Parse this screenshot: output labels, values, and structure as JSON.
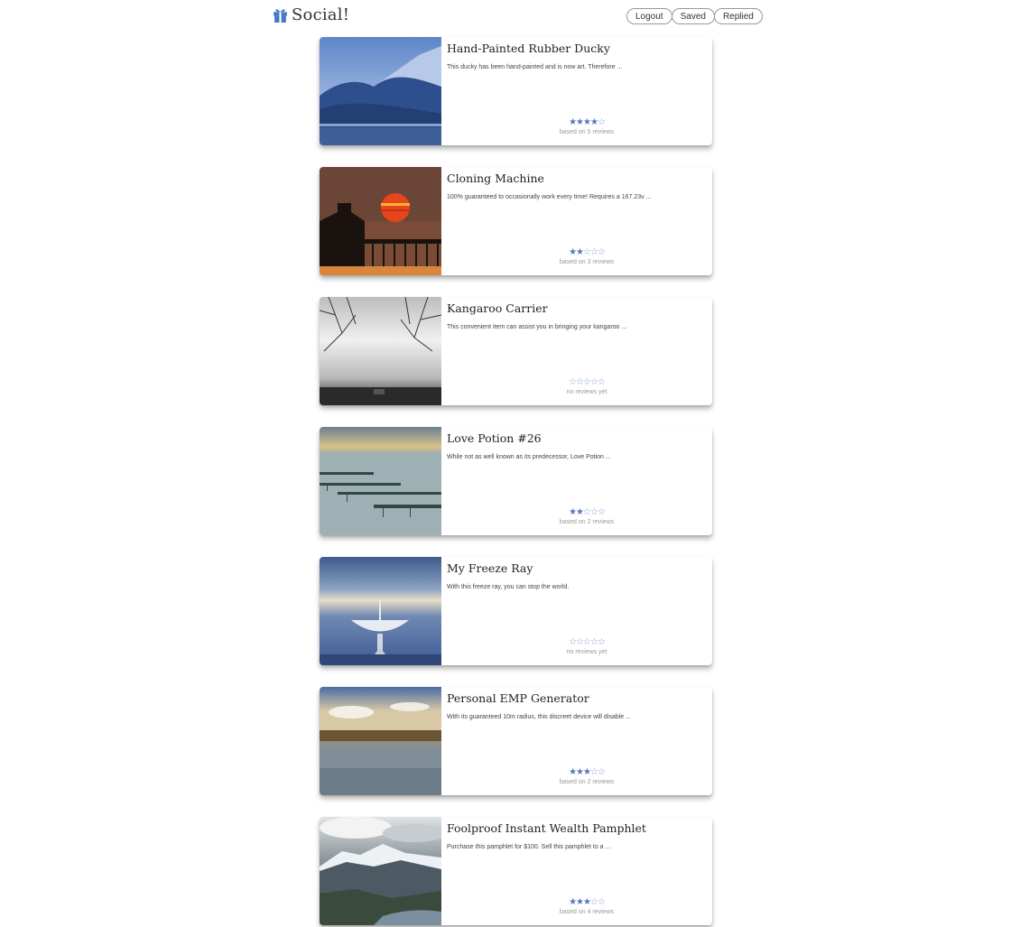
{
  "header": {
    "brand": "Social!",
    "brand_icon": "gift-icon",
    "nav": [
      "Logout",
      "Saved",
      "Replied"
    ]
  },
  "colors": {
    "accent": "#5577bb",
    "text": "#333333",
    "muted": "#999999"
  },
  "items": [
    {
      "title": "Hand-Painted Rubber Ducky",
      "description": "This ducky has been hand-painted and is now art. Therefore ...",
      "rating": 4,
      "reviews": "based on 5 reviews",
      "image": "mountain-lake-photo"
    },
    {
      "title": "Cloning Machine",
      "description": "100% guaranteed to occasionally work every time! Requires a 167.23v ...",
      "rating": 2,
      "reviews": "based on 3 reviews",
      "image": "sunset-pier-photo"
    },
    {
      "title": "Kangaroo Carrier",
      "description": "This convenient item can assist you in bringing your kangaroo ...",
      "rating": 0,
      "reviews": "no reviews yet",
      "image": "foggy-trees-photo"
    },
    {
      "title": "Love Potion #26",
      "description": "While not as well known as its predecessor, Love Potion ...",
      "rating": 2,
      "reviews": "based on 2 reviews",
      "image": "sea-piers-photo"
    },
    {
      "title": "My Freeze Ray",
      "description": "With this freeze ray, you can stop the world.",
      "rating": 0,
      "reviews": "no reviews yet",
      "image": "radio-telescope-photo"
    },
    {
      "title": "Personal EMP Generator",
      "description": "With its guaranteed 10m radius, this discreet device will disable ...",
      "rating": 3,
      "reviews": "based on 2 reviews",
      "image": "coastline-photo"
    },
    {
      "title": "Foolproof Instant Wealth Pamphlet",
      "description": "Purchase this pamphlet for $100. Sell this pamphlet to a ...",
      "rating": 3,
      "reviews": "based on 4 reviews",
      "image": "snowy-mountains-photo"
    }
  ]
}
